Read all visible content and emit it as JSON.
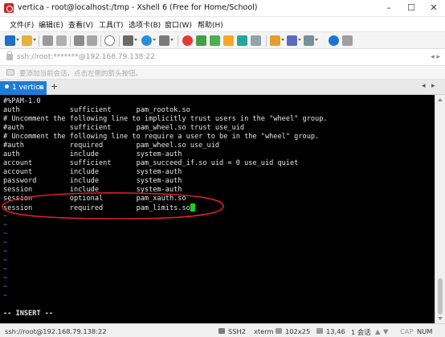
{
  "window": {
    "title": "vertica - root@localhost:/tmp - Xshell 6 (Free for Home/School)"
  },
  "menu": [
    "文件(F)",
    "编辑(E)",
    "查看(V)",
    "工具(T)",
    "选项卡(B)",
    "窗口(W)",
    "帮助(H)"
  ],
  "address": {
    "value": "ssh://root:*******@192.168.79.138:22"
  },
  "hint": {
    "text": "要添加当前会话，点击左侧的箭头按钮。"
  },
  "tabs": [
    {
      "label": "1 vertica",
      "close": "×"
    }
  ],
  "terminal": {
    "lines": [
      "#%PAM-1.0",
      "auth            sufficient      pam_rootok.so",
      "# Uncomment the following line to implicitly trust users in the \"wheel\" group.",
      "#auth           sufficient      pam_wheel.so trust use_uid",
      "# Uncomment the following line to require a user to be in the \"wheel\" group.",
      "#auth           required        pam_wheel.so use_uid",
      "auth            include         system-auth",
      "account         sufficient      pam_succeed_if.so uid = 0 use_uid quiet",
      "account         include         system-auth",
      "password        include         system-auth",
      "session         include         system-auth",
      "session         optional        pam_xauth.so",
      "session         required        pam_limits.so"
    ],
    "tilde": "~",
    "mode": "-- INSERT --"
  },
  "status": {
    "address": "ssh://root@192.168.79.138:22",
    "protocol": "SSH2",
    "term": "xterm",
    "size": "102x25",
    "position": "13,46",
    "sessions": "1 会话",
    "cap": "CAP",
    "num": "NUM"
  },
  "colors": {
    "tab_active": "#1f7cd6",
    "annotation": "#e0202a",
    "cursor": "#19d419",
    "tilde": "#4a8cf0"
  }
}
